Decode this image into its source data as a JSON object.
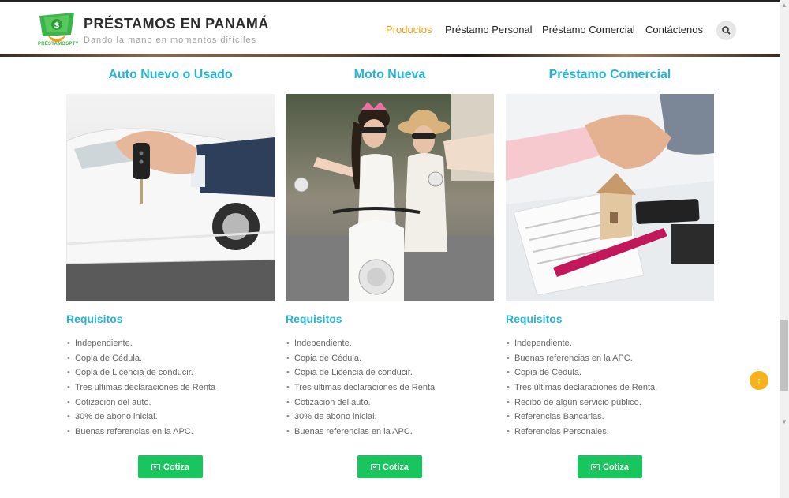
{
  "header": {
    "title": "PRÉSTAMOS EN PANAMÁ",
    "tagline": "Dando la mano en momentos difíciles",
    "logo_text": "PRÉSTAMOSPTY",
    "nav": [
      {
        "label": "Productos",
        "active": true
      },
      {
        "label": "Préstamo Personal",
        "active": false
      },
      {
        "label": "Préstamo Comercial",
        "active": false
      },
      {
        "label": "Contáctenos",
        "active": false
      }
    ],
    "search_icon": "search-icon"
  },
  "colors": {
    "accent": "#26b5d8",
    "nav_active": "#e8a317",
    "button": "#19c55d",
    "to_top": "#f5b21b"
  },
  "cards": [
    {
      "title": "Auto Nuevo o Usado",
      "image": "hand-holding-car-key-image",
      "requirements_title": "Requisitos",
      "requirements": [
        "Independiente.",
        "Copia de Cédula.",
        "Copia de Licencia de conducir.",
        "Tres ultimas declaraciones de Renta",
        "Cotización del auto.",
        "30% de abono inicial.",
        "Buenas referencias en la APC."
      ],
      "button_label": "Cotiza"
    },
    {
      "title": "Moto Nueva",
      "image": "two-women-on-scooter-image",
      "requirements_title": "Requisitos",
      "requirements": [
        "Independiente.",
        "Copia de Cédula.",
        "Copia de Licencia de conducir.",
        "Tres ultimas declaraciones de Renta",
        "Cotización del auto.",
        "30% de abono inicial.",
        "Buenas referencias en la APC."
      ],
      "button_label": "Cotiza"
    },
    {
      "title": "Préstamo Comercial",
      "image": "handshake-house-keys-image",
      "requirements_title": "Requisitos",
      "requirements": [
        "Independiente.",
        "Buenas referencias en la APC.",
        "Copia de Cédula.",
        "Tres últimas declaraciones de Renta.",
        "Recibo de algún servicio público.",
        "Referencias Bancarias.",
        "Referencias Personales."
      ],
      "button_label": "Cotiza"
    }
  ],
  "scroll_to_top_icon": "arrow-up-icon"
}
